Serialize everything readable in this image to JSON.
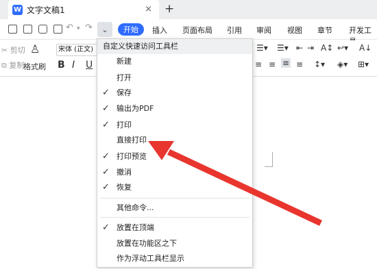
{
  "titlebar": {
    "doc_title": "文字文稿1",
    "app_icon": "wps-icon",
    "close": "×",
    "new_tab": "+"
  },
  "quick_toolbar": {
    "icons": [
      "save-icon",
      "export-pdf-icon",
      "print-icon",
      "print-preview-icon",
      "undo-icon",
      "redo-icon",
      "customize-dropdown-icon"
    ]
  },
  "menu_tabs": [
    "开始",
    "插入",
    "页面布局",
    "引用",
    "审阅",
    "视图",
    "章节",
    "开发工具"
  ],
  "ribbon": {
    "cut": "剪切",
    "copy": "复制",
    "format_painter": "格式刷",
    "font_name": "宋体 (正文)",
    "bold": "B",
    "italic": "I",
    "underline": "U"
  },
  "menu": {
    "header": "自定义快速访问工具栏",
    "items": [
      {
        "label": "新建",
        "checked": false
      },
      {
        "label": "打开",
        "checked": false
      },
      {
        "label": "保存",
        "checked": true
      },
      {
        "label": "输出为PDF",
        "checked": true
      },
      {
        "label": "打印",
        "checked": true
      },
      {
        "label": "直接打印",
        "checked": false
      },
      {
        "label": "打印预览",
        "checked": true
      },
      {
        "label": "撤消",
        "checked": true
      },
      {
        "label": "恢复",
        "checked": true
      }
    ],
    "more": "其他命令...",
    "position_items": [
      {
        "label": "放置在顶端",
        "checked": true
      },
      {
        "label": "放置在功能区之下",
        "checked": false
      },
      {
        "label": "作为浮动工具栏显示",
        "checked": false
      }
    ]
  },
  "colors": {
    "accent": "#2f6bff",
    "annotation_arrow": "#e8352e"
  }
}
